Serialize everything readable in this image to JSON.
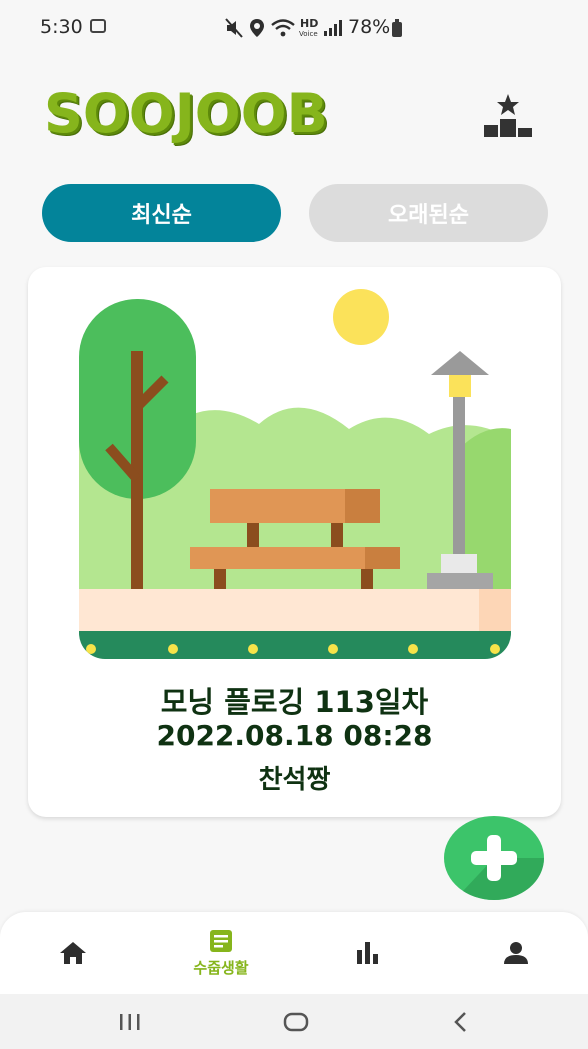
{
  "status_bar": {
    "time": "5:30",
    "network_label": "HD",
    "network_sublabel": "Voice",
    "battery": "78%"
  },
  "header": {
    "brand": "SOOJOOB",
    "rank_icon": "podium-star-icon"
  },
  "sort_tabs": [
    {
      "label": "최신순",
      "active": true
    },
    {
      "label": "오래된순",
      "active": false
    }
  ],
  "post": {
    "image_icon": "park-bench-illustration",
    "title": "모닝 플로깅 113일차",
    "datetime": "2022.08.18 08:28",
    "author": "찬석짱"
  },
  "fab": {
    "icon": "plus-icon"
  },
  "bottom_nav": {
    "items": [
      {
        "icon": "home-icon",
        "label": ""
      },
      {
        "icon": "document-icon",
        "label": "수줍생활",
        "active": true
      },
      {
        "icon": "bar-chart-icon",
        "label": ""
      },
      {
        "icon": "person-icon",
        "label": ""
      }
    ]
  },
  "system_nav": {
    "icons": [
      "recent-apps-icon",
      "home-circle-icon",
      "back-icon"
    ]
  },
  "colors": {
    "brand_green": "#86b51c",
    "active_tab": "#03849a",
    "inactive_tab": "#dcdcdc",
    "fab_green": "#3cc46a"
  }
}
